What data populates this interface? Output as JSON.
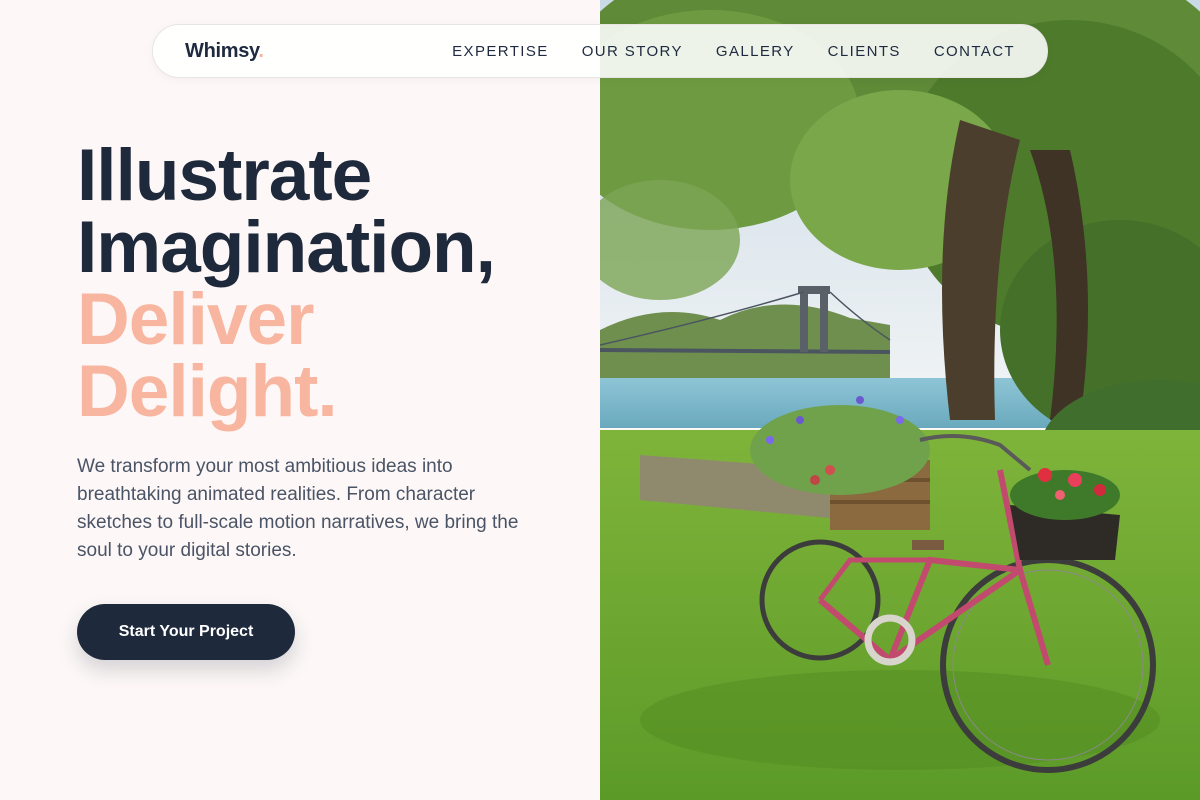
{
  "brand": {
    "name": "Whimsy",
    "dot": "."
  },
  "nav": {
    "links": [
      "EXPERTISE",
      "OUR STORY",
      "GALLERY",
      "CLIENTS",
      "CONTACT"
    ]
  },
  "hero": {
    "title_line1": "Illustrate",
    "title_line2": "Imagination,",
    "accent_line1": "Deliver",
    "accent_line2": "Delight.",
    "description": "We transform your most ambitious ideas into breathtaking animated realities. From character sketches to full-scale motion narratives, we bring the soul to your digital stories.",
    "cta_label": "Start Your Project"
  },
  "photo": {
    "subject": "pink bicycle with flower baskets under a tree by a river with a suspension bridge"
  },
  "colors": {
    "background": "#fdf8f7",
    "primary": "#1e293b",
    "accent": "#f8b5a0",
    "body_text": "#4a5466"
  }
}
